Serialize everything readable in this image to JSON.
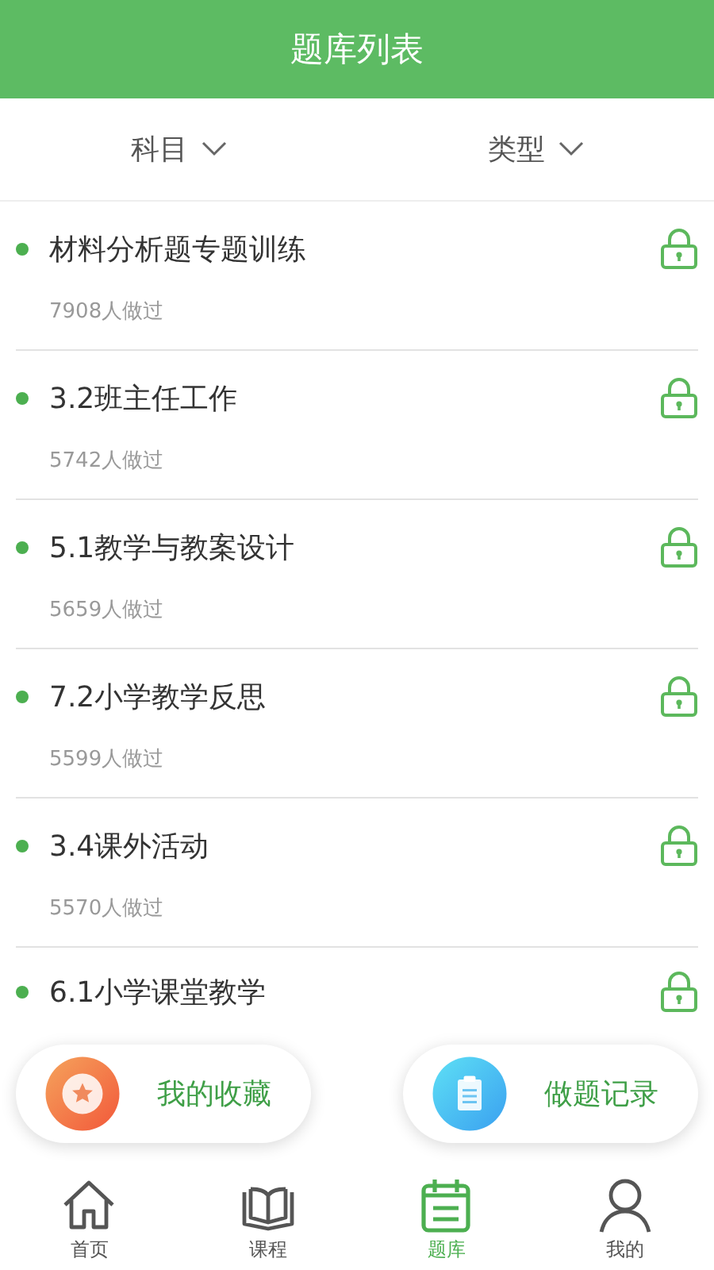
{
  "header": {
    "title": "题库列表"
  },
  "filters": [
    {
      "label": "科目"
    },
    {
      "label": "类型"
    }
  ],
  "items": [
    {
      "title": "材料分析题专题训练",
      "count": "7908人做过",
      "locked": true
    },
    {
      "title": "3.2班主任工作",
      "count": "5742人做过",
      "locked": true
    },
    {
      "title": "5.1教学与教案设计",
      "count": "5659人做过",
      "locked": true
    },
    {
      "title": "7.2小学教学反思",
      "count": "5599人做过",
      "locked": true
    },
    {
      "title": "3.4课外活动",
      "count": "5570人做过",
      "locked": true
    },
    {
      "title": "6.1小学课堂教学",
      "locked": true
    }
  ],
  "floating_buttons": [
    {
      "kind": "favorites",
      "label": "我的收藏"
    },
    {
      "kind": "records",
      "label": "做题记录"
    }
  ],
  "tab_bar": [
    {
      "kind": "home",
      "label": "首页",
      "selected": false
    },
    {
      "kind": "course",
      "label": "课程",
      "selected": false
    },
    {
      "kind": "bank",
      "label": "题库",
      "selected": true
    },
    {
      "kind": "me",
      "label": "我的",
      "selected": false
    }
  ]
}
